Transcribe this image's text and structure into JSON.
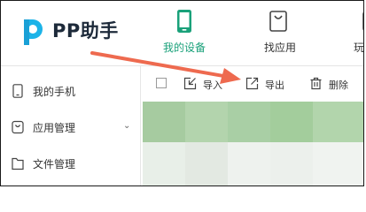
{
  "app": {
    "name": "PP助手",
    "accent_color": "#1aa17a",
    "logo_color": "#1cb3e8"
  },
  "nav": [
    {
      "label": "我的设备",
      "icon": "phone-icon",
      "active": true
    },
    {
      "label": "找应用",
      "icon": "shopping-bag-icon",
      "active": false
    },
    {
      "label": "玩",
      "icon": "more-nav-icon",
      "active": false
    }
  ],
  "sidebar": {
    "items": [
      {
        "label": "我的手机",
        "icon": "phone-outline-icon"
      },
      {
        "label": "应用管理",
        "icon": "app-manage-icon",
        "expanded": true
      },
      {
        "label": "文件管理",
        "icon": "folder-icon"
      }
    ]
  },
  "toolbar": {
    "import_label": "导入",
    "export_label": "导出",
    "delete_label": "删除"
  },
  "annotation": {
    "arrow_color": "#ee6a4f"
  }
}
